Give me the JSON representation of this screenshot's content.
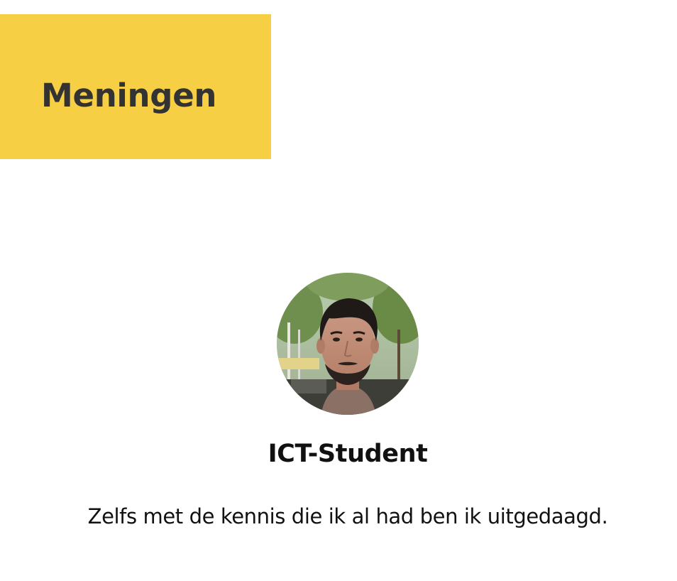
{
  "section": {
    "title": "Meningen",
    "accent_color": "#f7cf45"
  },
  "testimonial": {
    "avatar_icon": "person-photo",
    "role": "ICT-Student",
    "quote": "Zelfs met de kennis die ik al had ben ik uitgedaagd."
  }
}
